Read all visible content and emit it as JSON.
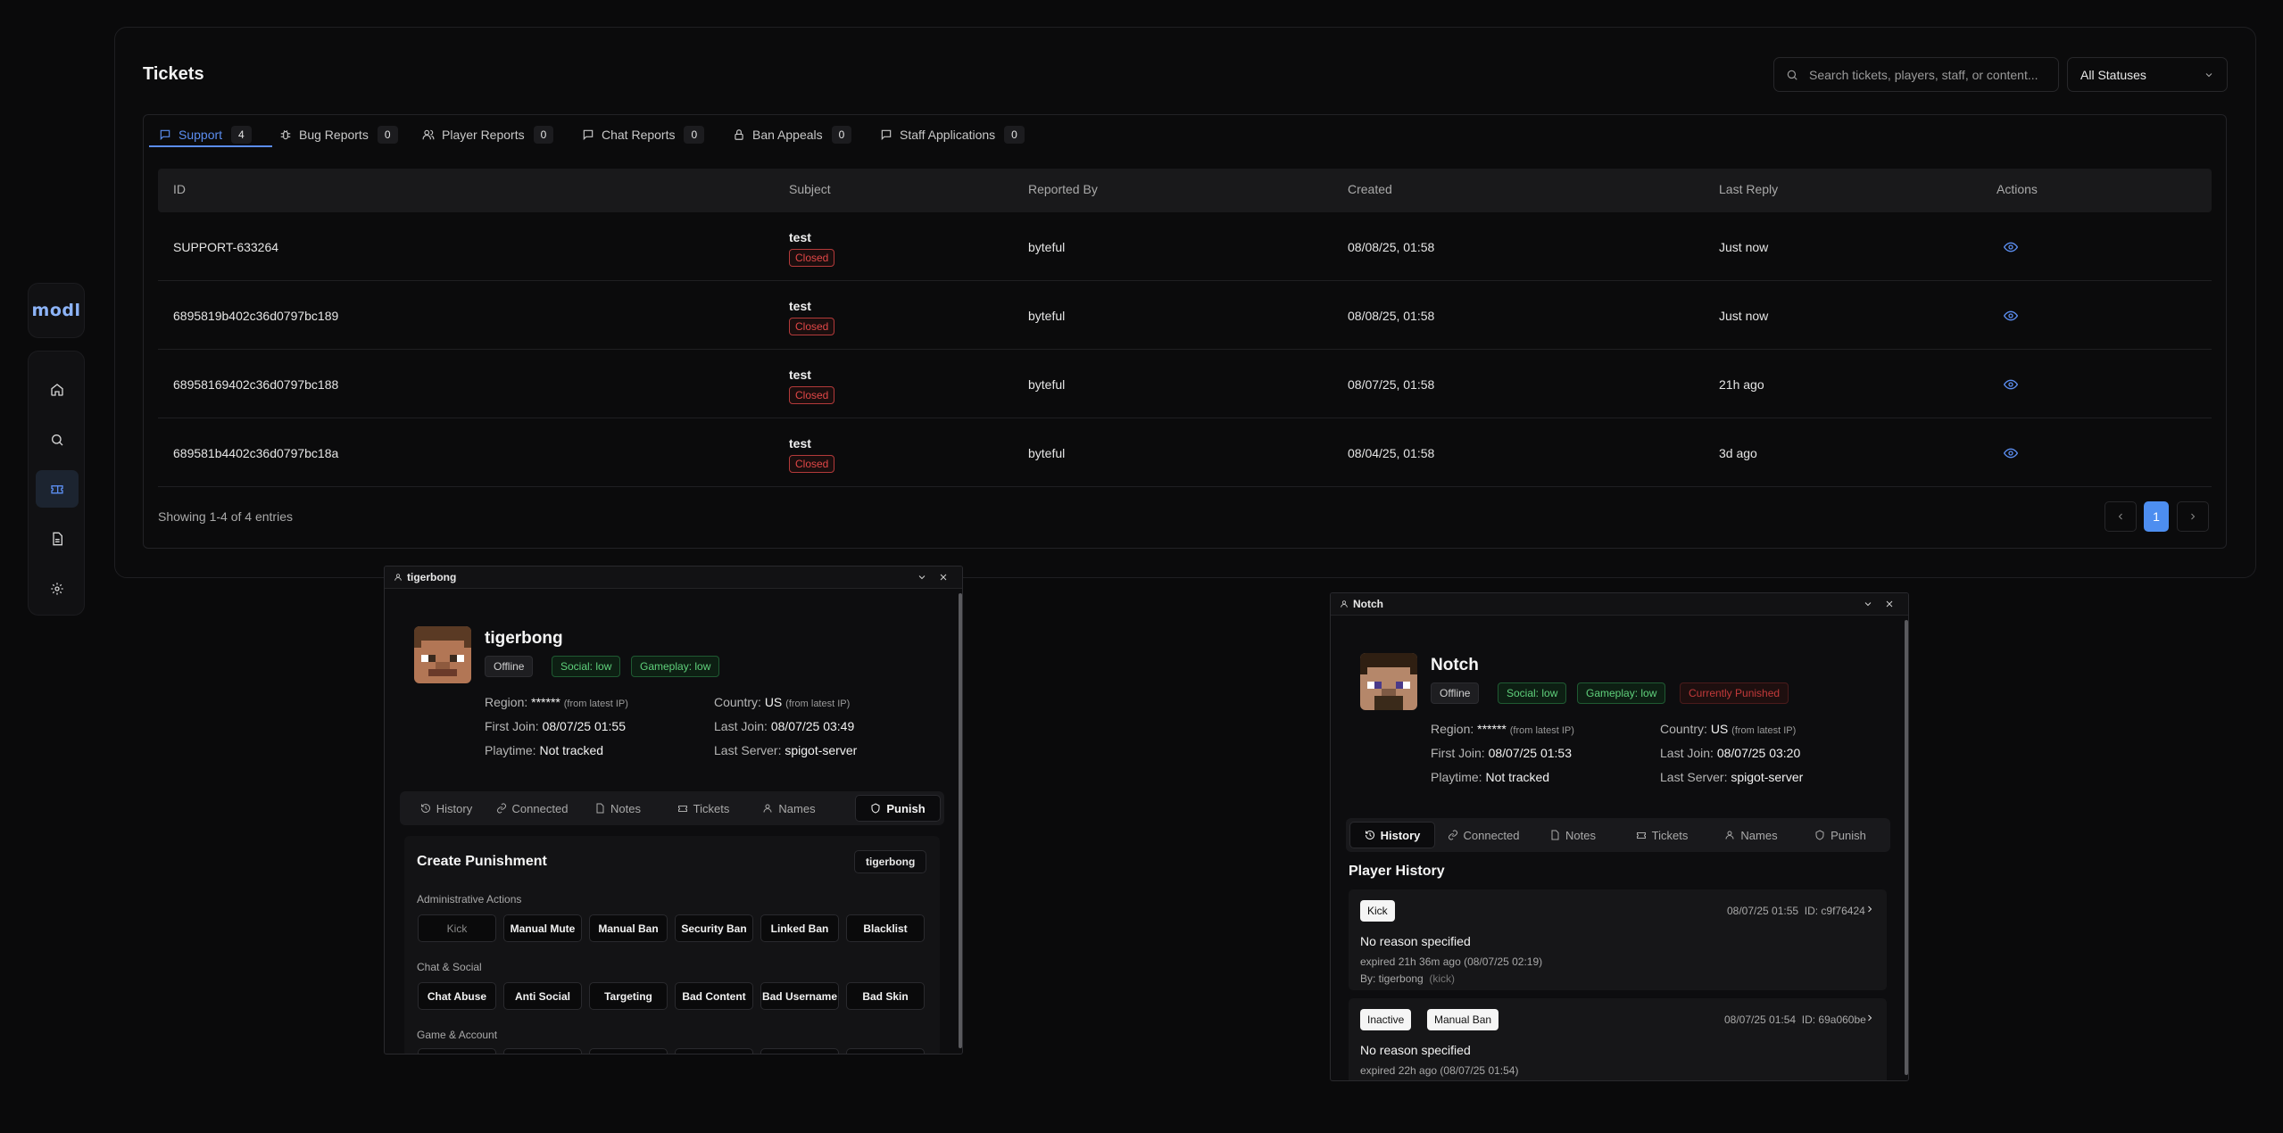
{
  "sidebar": {
    "logo": "modl",
    "items": [
      {
        "icon": "home-icon"
      },
      {
        "icon": "search-icon"
      },
      {
        "icon": "ticket-icon",
        "active": true
      },
      {
        "icon": "document-icon"
      },
      {
        "icon": "gear-icon"
      }
    ]
  },
  "tickets": {
    "title": "Tickets",
    "search_placeholder": "Search tickets, players, staff, or content...",
    "status_filter": "All Statuses",
    "tabs": [
      {
        "label": "Support",
        "count": "4",
        "icon": "message-icon",
        "active": true
      },
      {
        "label": "Bug Reports",
        "count": "0",
        "icon": "bug-icon"
      },
      {
        "label": "Player Reports",
        "count": "0",
        "icon": "users-icon"
      },
      {
        "label": "Chat Reports",
        "count": "0",
        "icon": "message-icon"
      },
      {
        "label": "Ban Appeals",
        "count": "0",
        "icon": "lock-icon"
      },
      {
        "label": "Staff Applications",
        "count": "0",
        "icon": "message-icon"
      }
    ],
    "columns": [
      "ID",
      "Subject",
      "Reported By",
      "Created",
      "Last Reply",
      "Actions"
    ],
    "rows": [
      {
        "id": "SUPPORT-633264",
        "subject": "test",
        "status": "Closed",
        "reported_by": "byteful",
        "created": "08/08/25, 01:58",
        "last_reply": "Just now"
      },
      {
        "id": "6895819b402c36d0797bc189",
        "subject": "test",
        "status": "Closed",
        "reported_by": "byteful",
        "created": "08/08/25, 01:58",
        "last_reply": "Just now"
      },
      {
        "id": "68958169402c36d0797bc188",
        "subject": "test",
        "status": "Closed",
        "reported_by": "byteful",
        "created": "08/07/25, 01:58",
        "last_reply": "21h ago"
      },
      {
        "id": "689581b4402c36d0797bc18a",
        "subject": "test",
        "status": "Closed",
        "reported_by": "byteful",
        "created": "08/04/25, 01:58",
        "last_reply": "3d ago"
      }
    ],
    "showing": "Showing 1-4 of 4 entries",
    "current_page": "1"
  },
  "player1": {
    "window_title": "tigerbong",
    "name": "tigerbong",
    "badges": [
      "Offline",
      "Social: low",
      "Gameplay: low"
    ],
    "region_label": "Region:",
    "region_value": "******",
    "region_note": "(from latest IP)",
    "country_label": "Country:",
    "country_value": "US",
    "country_note": "(from latest IP)",
    "first_join_label": "First Join:",
    "first_join": "08/07/25 01:55",
    "last_join_label": "Last Join:",
    "last_join": "08/07/25 03:49",
    "playtime_label": "Playtime:",
    "playtime": "Not tracked",
    "last_server_label": "Last Server:",
    "last_server": "spigot-server",
    "tabs": [
      "History",
      "Connected",
      "Notes",
      "Tickets",
      "Names",
      "Punish"
    ],
    "active_tab": "Punish",
    "punish": {
      "title": "Create Punishment",
      "target": "tigerbong",
      "admin_label": "Administrative Actions",
      "admin_actions": [
        "Kick",
        "Manual Mute",
        "Manual Ban",
        "Security Ban",
        "Linked Ban",
        "Blacklist"
      ],
      "chat_label": "Chat & Social",
      "chat_actions": [
        "Chat Abuse",
        "Anti Social",
        "Targeting",
        "Bad Content",
        "Bad Username",
        "Bad Skin"
      ],
      "game_label": "Game & Account"
    }
  },
  "player2": {
    "window_title": "Notch",
    "name": "Notch",
    "badges": [
      "Offline",
      "Social: low",
      "Gameplay: low",
      "Currently Punished"
    ],
    "region_label": "Region:",
    "region_value": "******",
    "region_note": "(from latest IP)",
    "country_label": "Country:",
    "country_value": "US",
    "country_note": "(from latest IP)",
    "first_join_label": "First Join:",
    "first_join": "08/07/25 01:53",
    "last_join_label": "Last Join:",
    "last_join": "08/07/25 03:20",
    "playtime_label": "Playtime:",
    "playtime": "Not tracked",
    "last_server_label": "Last Server:",
    "last_server": "spigot-server",
    "tabs": [
      "History",
      "Connected",
      "Notes",
      "Tickets",
      "Names",
      "Punish"
    ],
    "active_tab": "History",
    "history": {
      "title": "Player History",
      "entries": [
        {
          "badges": [
            "Kick"
          ],
          "date": "08/07/25 01:55",
          "id": "ID: c9f76424",
          "reason": "No reason specified",
          "expired": "expired 21h 36m ago (08/07/25 02:19)",
          "by": "By: tigerbong",
          "by_note": "(kick)"
        },
        {
          "badges": [
            "Inactive",
            "Manual Ban"
          ],
          "date": "08/07/25 01:54",
          "id": "ID: 69a060be",
          "reason": "No reason specified",
          "expired": "expired 22h ago (08/07/25 01:54)"
        }
      ]
    }
  },
  "colors": {
    "accent": "#5b8def",
    "danger": "#e14747",
    "success": "#5fd07b",
    "background": "#0a0a0b"
  }
}
